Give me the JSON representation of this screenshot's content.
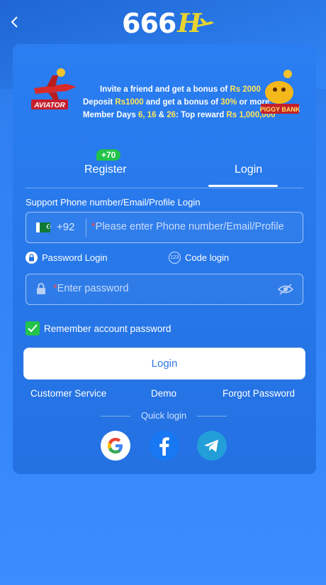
{
  "header": {
    "logo_text": "666",
    "logo_letter": "H"
  },
  "promo": {
    "line1": [
      "Invite a friend and get a bonus of ",
      "Rs 2000"
    ],
    "line2": [
      "Deposit ",
      "Rs1000",
      " and get a bonus of ",
      "30%",
      " or more"
    ],
    "line3": [
      "Member Days ",
      "6, 16",
      " & ",
      "26",
      ": Top reward ",
      "Rs 1,000,000"
    ],
    "left_game": "AVIATOR",
    "right_game": "PIGGY BANK"
  },
  "tabs": {
    "register": "Register",
    "register_badge": "+70",
    "login": "Login",
    "active": "login"
  },
  "form": {
    "support_label": "Support Phone number/Email/Profile Login",
    "country_code": "+92",
    "required_mark": "*",
    "phone_placeholder": "Please enter Phone number/Email/Profile",
    "password_login_label": "Password Login",
    "code_login_label": "Code login",
    "code_icon_text": "123",
    "password_placeholder": "Enter password",
    "remember_label": "Remember account password",
    "remember_checked": true,
    "login_button": "Login"
  },
  "links": {
    "customer_service": "Customer Service",
    "demo": "Demo",
    "forgot_password": "Forgot Password"
  },
  "quick_login": {
    "label": "Quick login",
    "providers": [
      "google-icon",
      "facebook-icon",
      "telegram-icon"
    ]
  },
  "colors": {
    "background": "#3a8cff",
    "card": "#2a7ef1",
    "accent_green": "#22c34a",
    "highlight_yellow": "#ffe45a"
  }
}
